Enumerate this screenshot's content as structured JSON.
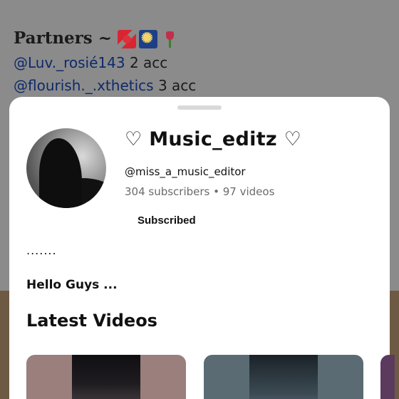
{
  "background": {
    "partners_title": "Partners ~",
    "partners_emojis": [
      "ribbon-emoji",
      "fireworks-emoji",
      "tulip-emoji"
    ],
    "partners": [
      {
        "handle": "@Luv._rosié143",
        "count": "2 acc"
      },
      {
        "handle": "@flourish._.xthetics",
        "count": "3 acc"
      }
    ]
  },
  "sheet": {
    "channel_name": "♡ Music_editz ♡",
    "handle": "@miss_a_music_editor",
    "stats": "304 subscribers • 97 videos",
    "subscribe_label": "Subscribed",
    "description_lines": [
      ".......",
      "Hello Guys ..."
    ],
    "latest_videos_title": "Latest Videos"
  },
  "colors": {
    "sheet_bg": "#ffffff",
    "handle_link": "#0d2a6a",
    "stats_text": "#6b6b6b"
  }
}
